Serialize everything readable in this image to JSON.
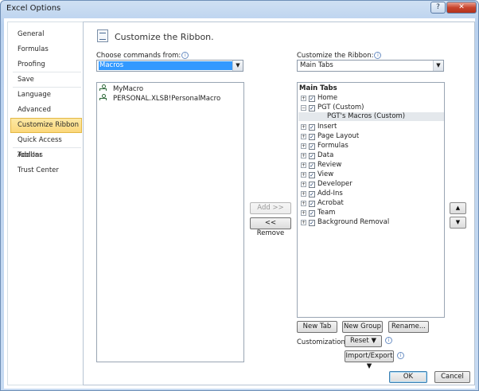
{
  "window": {
    "title": "Excel Options",
    "help_glyph": "?",
    "close_glyph": "✕"
  },
  "nav": {
    "items": [
      {
        "label": "General"
      },
      {
        "label": "Formulas"
      },
      {
        "label": "Proofing"
      },
      {
        "label": "Save"
      },
      {
        "label": "Language"
      },
      {
        "label": "Advanced"
      },
      {
        "label": "Customize Ribbon",
        "selected": true
      },
      {
        "label": "Quick Access Toolbar"
      },
      {
        "label": "Add-Ins"
      },
      {
        "label": "Trust Center"
      }
    ]
  },
  "header": {
    "title": "Customize the Ribbon.",
    "icon": "customize-ribbon-icon"
  },
  "left_panel": {
    "label": "Choose commands from:",
    "info_glyph": "i",
    "combo_value": "Macros",
    "items": [
      {
        "label": "MyMacro",
        "icon": "macro-icon"
      },
      {
        "label": "PERSONAL.XLSB!PersonalMacro",
        "icon": "macro-icon"
      }
    ]
  },
  "middle": {
    "add_label": "Add >>",
    "remove_label": "<< Remove"
  },
  "right_panel": {
    "label": "Customize the Ribbon:",
    "info_glyph": "i",
    "combo_value": "Main Tabs",
    "tree_header": "Main Tabs",
    "tree": [
      {
        "label": "Home",
        "expanded": false,
        "checked": true
      },
      {
        "label": "PGT (Custom)",
        "expanded": true,
        "checked": true
      },
      {
        "label": "PGT's Macros (Custom)",
        "is_group": true
      },
      {
        "label": "Insert",
        "expanded": false,
        "checked": true
      },
      {
        "label": "Page Layout",
        "expanded": false,
        "checked": true
      },
      {
        "label": "Formulas",
        "expanded": false,
        "checked": true
      },
      {
        "label": "Data",
        "expanded": false,
        "checked": true
      },
      {
        "label": "Review",
        "expanded": false,
        "checked": true
      },
      {
        "label": "View",
        "expanded": false,
        "checked": true
      },
      {
        "label": "Developer",
        "expanded": false,
        "checked": true
      },
      {
        "label": "Add-Ins",
        "expanded": false,
        "checked": true
      },
      {
        "label": "Acrobat",
        "expanded": false,
        "checked": true
      },
      {
        "label": "Team",
        "expanded": false,
        "checked": true
      },
      {
        "label": "Background Removal",
        "expanded": false,
        "checked": true
      }
    ],
    "new_tab_label": "New Tab",
    "new_group_label": "New Group",
    "rename_label": "Rename...",
    "customizations_label": "Customizations:",
    "reset_label": "Reset ▼",
    "import_export_label": "Import/Export ▼",
    "move_up_glyph": "▲",
    "move_down_glyph": "▼"
  },
  "footer": {
    "ok_label": "OK",
    "cancel_label": "Cancel"
  },
  "glyphs": {
    "combo_arrow": "▼",
    "expand": "+",
    "collapse": "−",
    "check": "✓"
  }
}
